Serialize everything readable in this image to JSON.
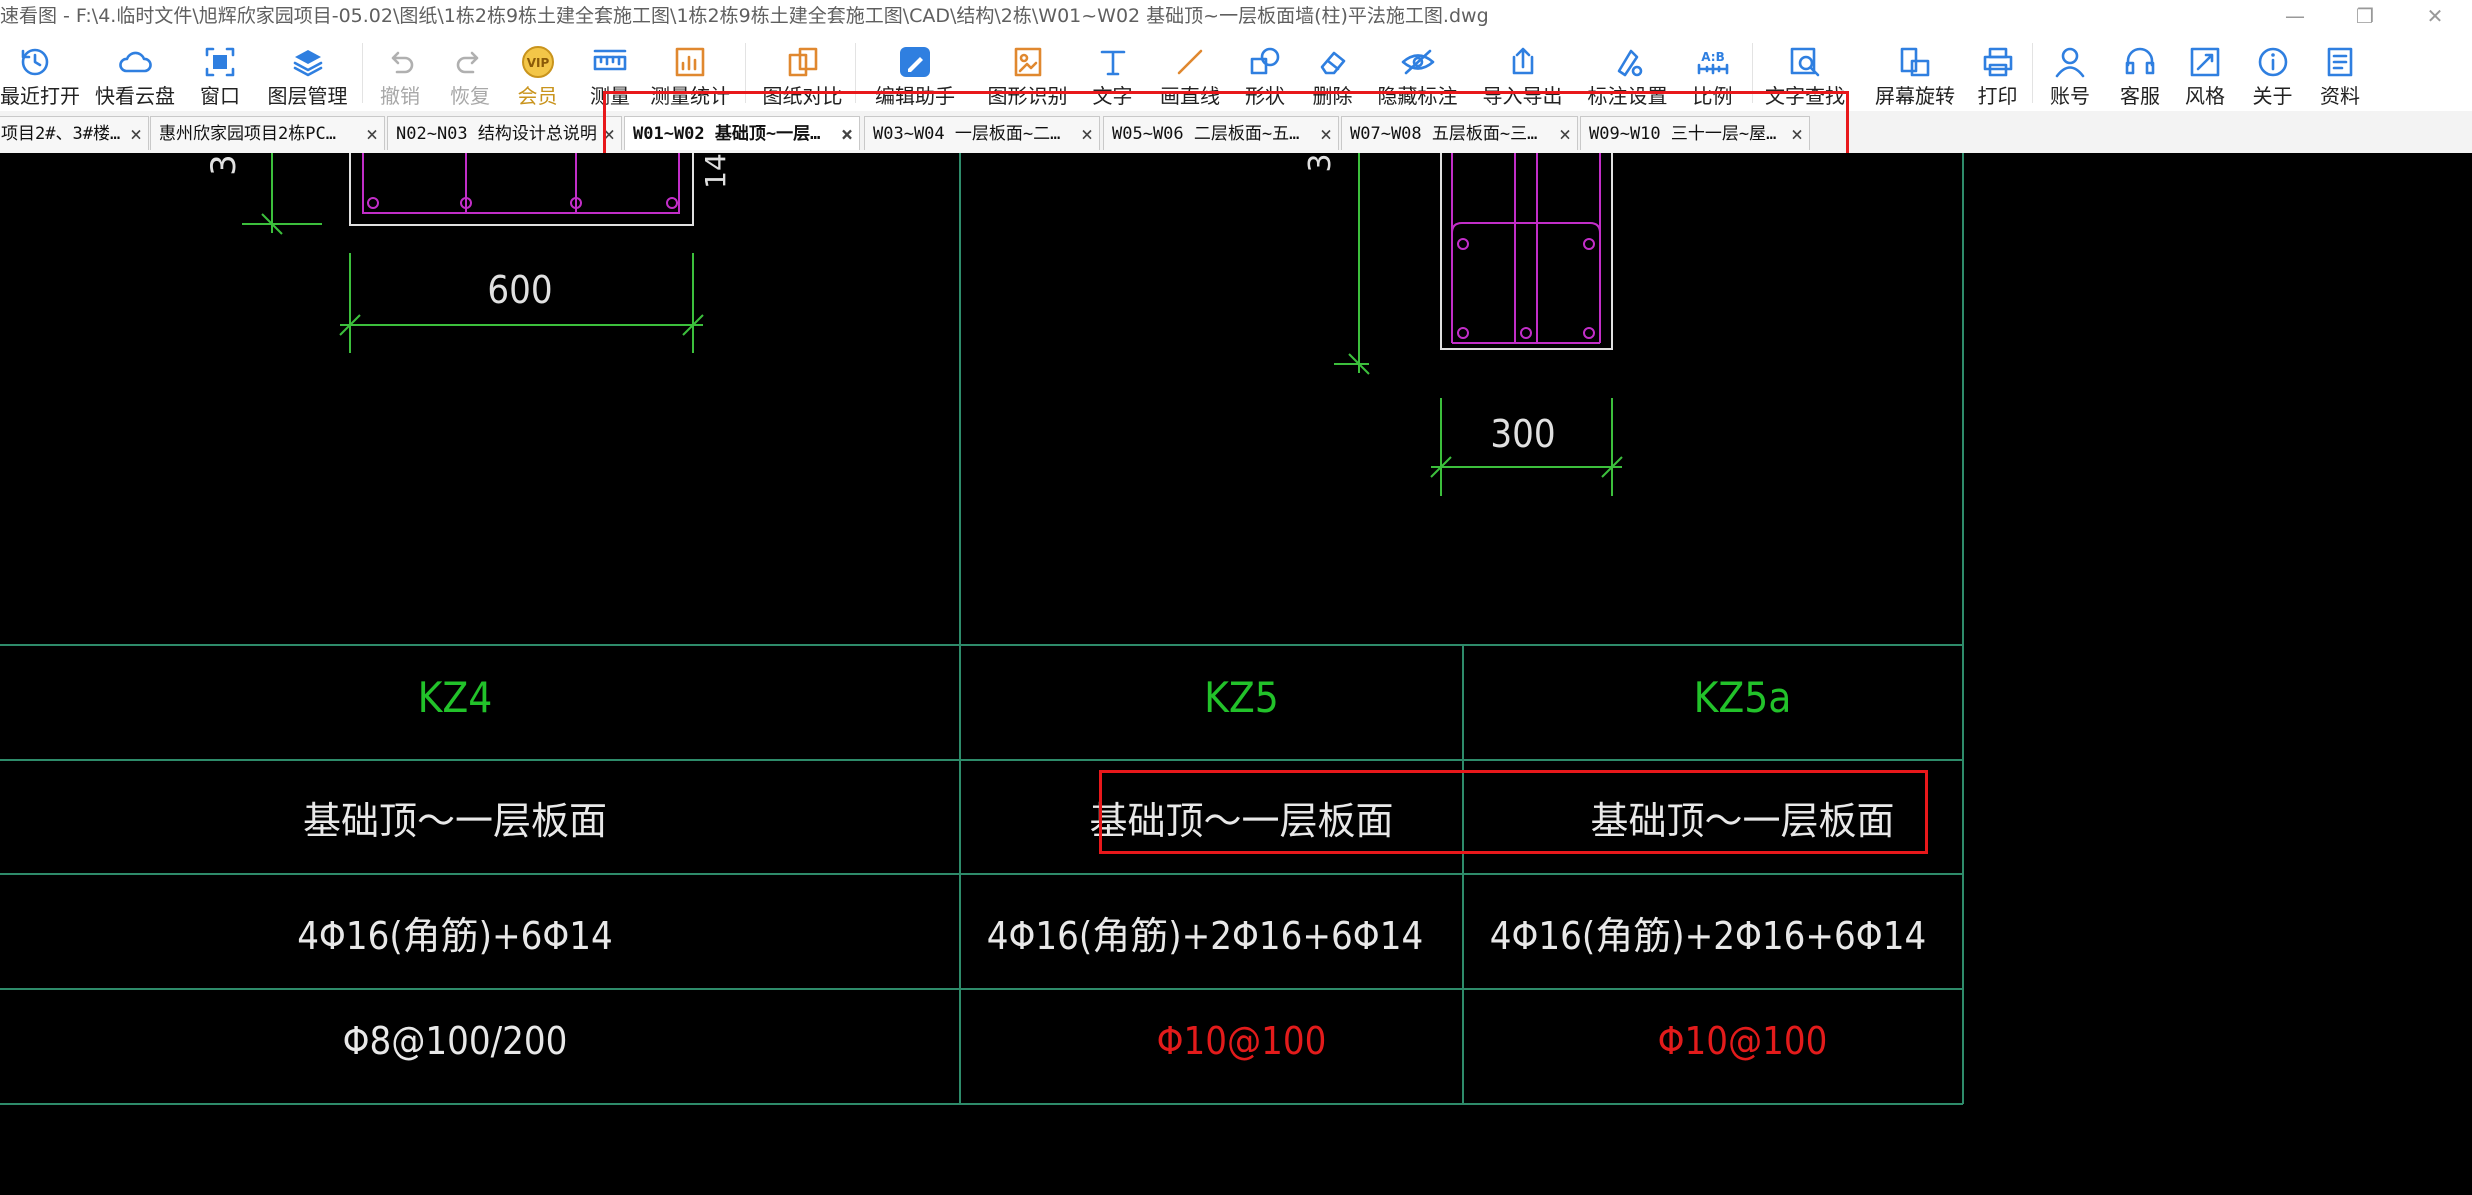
{
  "window": {
    "title": "速看图 - F:\\4.临时文件\\旭辉欣家园项目-05.02\\图纸\\1栋2栋9栋土建全套施工图\\1栋2栋9栋土建全套施工图\\CAD\\结构\\2栋\\W01~W02 基础顶~一层板面墙(柱)平法施工图.dwg",
    "minimize": "—",
    "restore": "❐",
    "close": "✕"
  },
  "toolbar": [
    {
      "label": "最近打开",
      "icon": "clock-icon",
      "color": "#2f7fe0"
    },
    {
      "label": "快看云盘",
      "icon": "cloud-icon",
      "color": "#2f7fe0"
    },
    {
      "label": "窗口",
      "icon": "window-fit-icon",
      "color": "#2f7fe0"
    },
    {
      "label": "图层管理",
      "icon": "layers-icon",
      "color": "#2f7fe0"
    },
    {
      "label": "撤销",
      "icon": "undo-icon",
      "color": "#b0b0b0",
      "disabled": true
    },
    {
      "label": "恢复",
      "icon": "redo-icon",
      "color": "#b0b0b0",
      "disabled": true
    },
    {
      "label": "会员",
      "icon": "vip-icon",
      "color": "#c9941d",
      "vip": true,
      "badge": "VIP"
    },
    {
      "label": "测量",
      "icon": "ruler-icon",
      "color": "#2f7fe0"
    },
    {
      "label": "测量统计",
      "icon": "measure-stats-icon",
      "color": "#e0882f"
    },
    {
      "label": "图纸对比",
      "icon": "compare-icon",
      "color": "#e0882f"
    },
    {
      "label": "编辑助手",
      "icon": "edit-assistant-icon",
      "color": "#2f7fe0"
    },
    {
      "label": "图形识别",
      "icon": "shape-recognize-icon",
      "color": "#e0882f"
    },
    {
      "label": "文字",
      "icon": "text-icon",
      "color": "#2f7fe0"
    },
    {
      "label": "画直线",
      "icon": "line-icon",
      "color": "#e0882f"
    },
    {
      "label": "形状",
      "icon": "shape-icon",
      "color": "#2f7fe0"
    },
    {
      "label": "删除",
      "icon": "eraser-icon",
      "color": "#2f7fe0"
    },
    {
      "label": "隐藏标注",
      "icon": "eye-hide-icon",
      "color": "#2f7fe0"
    },
    {
      "label": "导入导出",
      "icon": "import-export-icon",
      "color": "#2f7fe0"
    },
    {
      "label": "标注设置",
      "icon": "annotation-settings-icon",
      "color": "#2f7fe0"
    },
    {
      "label": "比例",
      "icon": "scale-icon",
      "color": "#2f7fe0",
      "badge": "A:B"
    },
    {
      "label": "文字查找",
      "icon": "text-search-icon",
      "color": "#2f7fe0"
    },
    {
      "label": "屏幕旋转",
      "icon": "rotate-screen-icon",
      "color": "#2f7fe0"
    },
    {
      "label": "打印",
      "icon": "printer-icon",
      "color": "#2f7fe0"
    },
    {
      "label": "账号",
      "icon": "user-icon",
      "color": "#2f7fe0"
    },
    {
      "label": "客服",
      "icon": "headset-icon",
      "color": "#2f7fe0"
    },
    {
      "label": "风格",
      "icon": "style-icon",
      "color": "#2f7fe0"
    },
    {
      "label": "关于",
      "icon": "info-icon",
      "color": "#2f7fe0"
    },
    {
      "label": "资料",
      "icon": "docs-icon",
      "color": "#2f7fe0"
    }
  ],
  "tabs": [
    {
      "label": "项目2#、3#楼…",
      "active": false
    },
    {
      "label": "惠州欣家园项目2栋PC…",
      "active": false
    },
    {
      "label": "N02~N03 结构设计总说明",
      "active": false
    },
    {
      "label": "W01~W02 基础顶~一层…",
      "active": true
    },
    {
      "label": "W03~W04 一层板面~二…",
      "active": false
    },
    {
      "label": "W05~W06 二层板面~五…",
      "active": false
    },
    {
      "label": "W07~W08 五层板面~三…",
      "active": false
    },
    {
      "label": "W09~W10 三十一层~屋…",
      "active": false
    }
  ],
  "tab_close": "×",
  "drawing": {
    "dims": {
      "d600": "600",
      "d300": "300",
      "d14": "14",
      "d3": "3"
    },
    "columns": [
      "KZ4",
      "KZ5",
      "KZ5a"
    ],
    "rows": {
      "elevation": [
        "基础顶～一层板面",
        "基础顶～一层板面",
        "基础顶～一层板面"
      ],
      "longitudinal": [
        "4Φ16(角筋)+6Φ14",
        "4Φ16(角筋)+2Φ16+6Φ14",
        "4Φ16(角筋)+2Φ16+6Φ14"
      ],
      "stirrup": [
        "Φ8@100/200",
        "Φ10@100",
        "Φ10@100"
      ]
    },
    "colors": {
      "grid": "#2e8b6a",
      "dim": "#3cbf3c",
      "rebar": "#c22ec8",
      "outline": "#e0e0e0",
      "title": "#22c22a",
      "highlight": "#e8181b"
    }
  }
}
